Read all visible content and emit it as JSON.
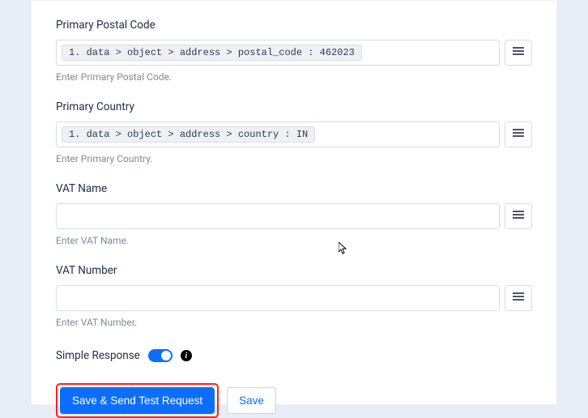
{
  "fields": {
    "primary_postal_code": {
      "label": "Primary Postal Code",
      "pill": "1. data > object > address > postal_code : 462023",
      "help": "Enter Primary Postal Code."
    },
    "primary_country": {
      "label": "Primary Country",
      "pill": "1. data > object > address > country : IN",
      "help": "Enter Primary Country."
    },
    "vat_name": {
      "label": "VAT Name",
      "help": "Enter VAT Name."
    },
    "vat_number": {
      "label": "VAT Number",
      "help": "Enter VAT Number."
    }
  },
  "toggle": {
    "label": "Simple Response"
  },
  "buttons": {
    "primary": "Save & Send Test Request",
    "secondary": "Save"
  }
}
